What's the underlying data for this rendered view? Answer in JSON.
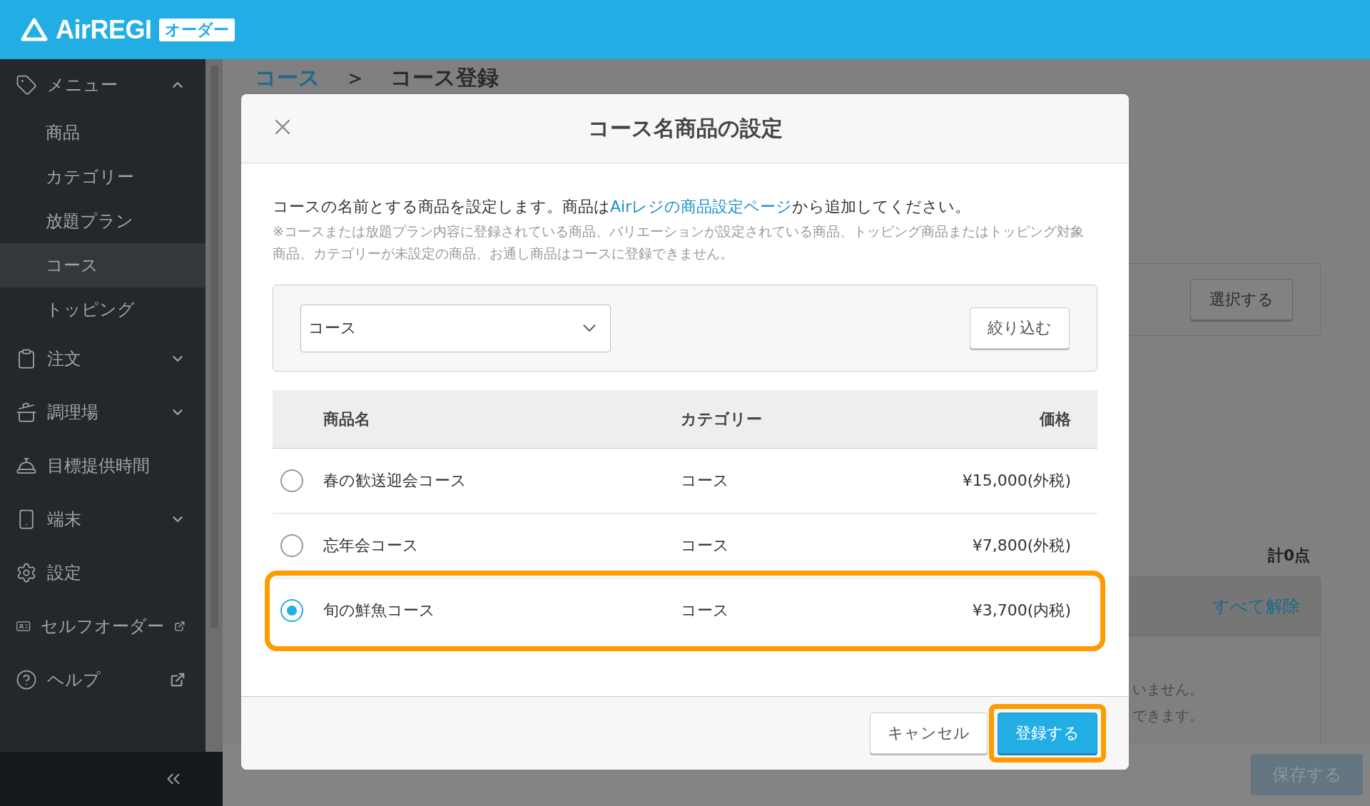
{
  "header": {
    "logo": "AirREGI",
    "badge": "オーダー"
  },
  "sidebar": {
    "items": [
      {
        "kind": "group",
        "label": "メニュー",
        "expanded": true,
        "children": [
          {
            "label": "商品",
            "selected": false
          },
          {
            "label": "カテゴリー",
            "selected": false
          },
          {
            "label": "放題プラン",
            "selected": false
          },
          {
            "label": "コース",
            "selected": true
          },
          {
            "label": "トッピング",
            "selected": false
          }
        ]
      },
      {
        "kind": "group",
        "label": "注文",
        "expanded": false
      },
      {
        "kind": "group",
        "label": "調理場",
        "expanded": false
      },
      {
        "kind": "link",
        "label": "目標提供時間"
      },
      {
        "kind": "group",
        "label": "端末",
        "expanded": false
      },
      {
        "kind": "link",
        "label": "設定"
      },
      {
        "kind": "external",
        "label": "セルフオーダー"
      },
      {
        "kind": "external",
        "label": "ヘルプ"
      }
    ]
  },
  "page": {
    "breadcrumb": [
      {
        "kind": "link",
        "label": "コース"
      },
      {
        "kind": "separator",
        "label": "＞"
      },
      {
        "kind": "current",
        "label": "コース登録"
      }
    ],
    "select_button": "選択する",
    "total": "計0点",
    "clear_all": "すべて解除",
    "empty_lines": [
      "いません。",
      "できます。"
    ],
    "save_button": {
      "label": "保存する",
      "disabled": true
    }
  },
  "dialog": {
    "title": "コース名商品の設定",
    "description": "コースの名前とする商品を設定します。商品は",
    "link": "Airレジの商品設定ページ",
    "description_end": "から追加してください。",
    "note": "※コースまたは放題プラン内容に登録されている商品、バリエーションが設定されている商品、トッピング商品またはトッピング対象商品、カテゴリーが未設定の商品、お通し商品はコースに登録できません。",
    "filter": {
      "value": "コース",
      "button": "絞り込む"
    },
    "table": {
      "columns": [
        "商品名",
        "カテゴリー",
        "価格"
      ],
      "rows": [
        {
          "name": "春の歓送迎会コース",
          "category": "コース",
          "price": "¥15,000(外税)",
          "selected": false,
          "highlighted": false
        },
        {
          "name": "忘年会コース",
          "category": "コース",
          "price": "¥7,800(外税)",
          "selected": false,
          "highlighted": false
        },
        {
          "name": "旬の鮮魚コース",
          "category": "コース",
          "price": "¥3,700(内税)",
          "selected": true,
          "highlighted": true
        }
      ]
    },
    "buttons": [
      {
        "kind": "secondary",
        "label": "キャンセル",
        "highlighted": false
      },
      {
        "kind": "primary",
        "label": "登録する",
        "highlighted": true
      }
    ]
  }
}
